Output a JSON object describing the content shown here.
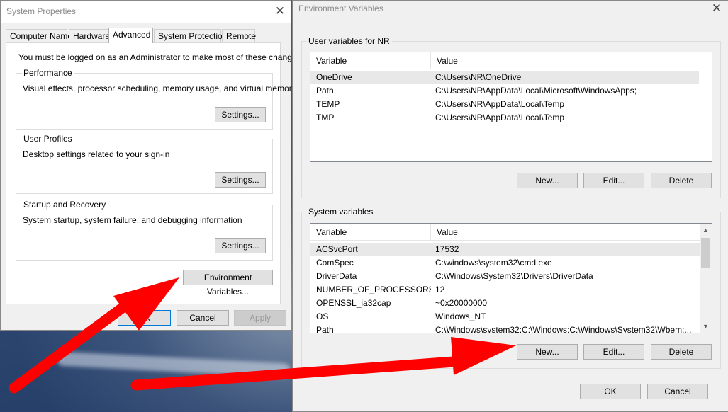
{
  "system_properties": {
    "title": "System Properties",
    "close": "✕",
    "tabs": [
      "Computer Name",
      "Hardware",
      "Advanced",
      "System Protection",
      "Remote"
    ],
    "active_tab": "Advanced",
    "admin_notice": "You must be logged on as an Administrator to make most of these changes.",
    "performance": {
      "label": "Performance",
      "description": "Visual effects, processor scheduling, memory usage, and virtual memory",
      "button": "Settings..."
    },
    "user_profiles": {
      "label": "User Profiles",
      "description": "Desktop settings related to your sign-in",
      "button": "Settings..."
    },
    "startup_recovery": {
      "label": "Startup and Recovery",
      "description": "System startup, system failure, and debugging information",
      "button": "Settings..."
    },
    "env_button": "Environment Variables...",
    "ok_button": "OK",
    "cancel_button": "Cancel",
    "apply_button": "Apply"
  },
  "environment_variables": {
    "title": "Environment Variables",
    "close": "✕",
    "user_section": {
      "label": "User variables for NR",
      "columns": [
        "Variable",
        "Value"
      ],
      "rows": [
        {
          "variable": "OneDrive",
          "value": "C:\\Users\\NR\\OneDrive"
        },
        {
          "variable": "Path",
          "value": "C:\\Users\\NR\\AppData\\Local\\Microsoft\\WindowsApps;"
        },
        {
          "variable": "TEMP",
          "value": "C:\\Users\\NR\\AppData\\Local\\Temp"
        },
        {
          "variable": "TMP",
          "value": "C:\\Users\\NR\\AppData\\Local\\Temp"
        }
      ],
      "selected_row": 0,
      "buttons": {
        "new": "New...",
        "edit": "Edit...",
        "delete": "Delete"
      }
    },
    "system_section": {
      "label": "System variables",
      "columns": [
        "Variable",
        "Value"
      ],
      "rows": [
        {
          "variable": "ACSvcPort",
          "value": "17532"
        },
        {
          "variable": "ComSpec",
          "value": "C:\\windows\\system32\\cmd.exe"
        },
        {
          "variable": "DriverData",
          "value": "C:\\Windows\\System32\\Drivers\\DriverData"
        },
        {
          "variable": "NUMBER_OF_PROCESSORS",
          "value": "12"
        },
        {
          "variable": "OPENSSL_ia32cap",
          "value": "~0x20000000"
        },
        {
          "variable": "OS",
          "value": "Windows_NT"
        },
        {
          "variable": "Path",
          "value": "C:\\Windows\\system32;C:\\Windows;C:\\Windows\\System32\\Wbem;..."
        }
      ],
      "selected_row": 0,
      "buttons": {
        "new": "New...",
        "edit": "Edit...",
        "delete": "Delete"
      },
      "scroll_up": "▲",
      "scroll_down": "▼"
    },
    "ok_button": "OK",
    "cancel_button": "Cancel"
  },
  "annotations": {
    "arrow_color": "#ff0000",
    "arrow_count": 2
  }
}
